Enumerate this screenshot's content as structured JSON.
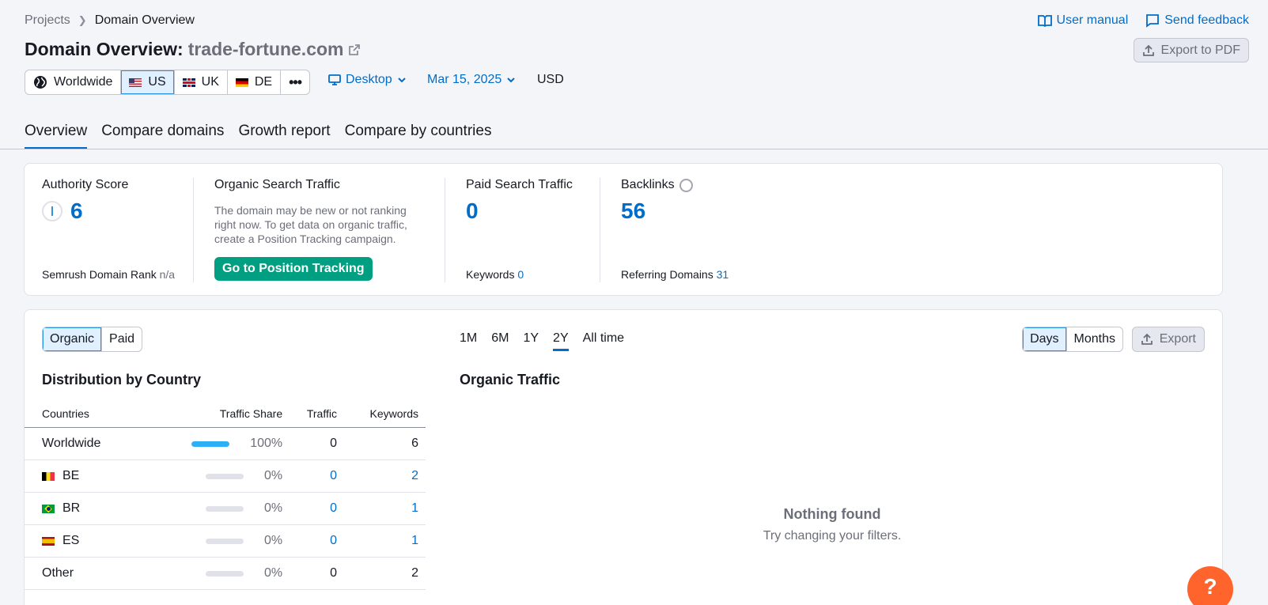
{
  "breadcrumb": {
    "parent": "Projects",
    "current": "Domain Overview"
  },
  "header_links": {
    "manual": "User manual",
    "feedback": "Send feedback"
  },
  "title": {
    "prefix": "Domain Overview:",
    "domain": "trade-fortune.com"
  },
  "export_pdf": "Export to PDF",
  "databases": [
    {
      "label": "Worldwide",
      "flag": "globe-icon"
    },
    {
      "label": "US",
      "flag": "flag-us",
      "active": true
    },
    {
      "label": "UK",
      "flag": "flag-uk"
    },
    {
      "label": "DE",
      "flag": "flag-de"
    }
  ],
  "filters": {
    "device": "Desktop",
    "date": "Mar 15, 2025",
    "currency": "USD"
  },
  "tabs": [
    "Overview",
    "Compare domains",
    "Growth report",
    "Compare by countries"
  ],
  "summary": {
    "authority": {
      "label": "Authority Score",
      "value": "6",
      "foot_label": "Semrush Domain Rank",
      "foot_value": "n/a"
    },
    "organic": {
      "label": "Organic Search Traffic",
      "desc": "The domain may be new or not ranking right now. To get data on organic traffic, create a Position Tracking campaign.",
      "button": "Go to Position Tracking"
    },
    "paid": {
      "label": "Paid Search Traffic",
      "value": "0",
      "foot_label": "Keywords",
      "foot_value": "0"
    },
    "backlinks": {
      "label": "Backlinks",
      "value": "56",
      "foot_label": "Referring Domains",
      "foot_value": "31"
    }
  },
  "controls": {
    "type_toggle": [
      "Organic",
      "Paid"
    ],
    "periods": [
      "1M",
      "6M",
      "1Y",
      "2Y",
      "All time"
    ],
    "granularity": [
      "Days",
      "Months"
    ],
    "export": "Export"
  },
  "distribution": {
    "title": "Distribution by Country",
    "columns": [
      "Countries",
      "Traffic Share",
      "Traffic",
      "Keywords"
    ],
    "rows": [
      {
        "country": "Worldwide",
        "flag": "",
        "share": "100%",
        "share_value": 1.0,
        "traffic": "0",
        "keywords": "6"
      },
      {
        "country": "BE",
        "flag": "flag-be",
        "share": "0%",
        "share_value": 0,
        "traffic": "0",
        "keywords": "2"
      },
      {
        "country": "BR",
        "flag": "flag-br",
        "share": "0%",
        "share_value": 0,
        "traffic": "0",
        "keywords": "1"
      },
      {
        "country": "ES",
        "flag": "flag-es",
        "share": "0%",
        "share_value": 0,
        "traffic": "0",
        "keywords": "1"
      },
      {
        "country": "Other",
        "flag": "",
        "share": "0%",
        "share_value": 0,
        "traffic": "0",
        "keywords": "2"
      }
    ]
  },
  "organic_traffic": {
    "title": "Organic Traffic",
    "empty_title": "Nothing found",
    "empty_sub": "Try changing your filters."
  },
  "help": "?"
}
